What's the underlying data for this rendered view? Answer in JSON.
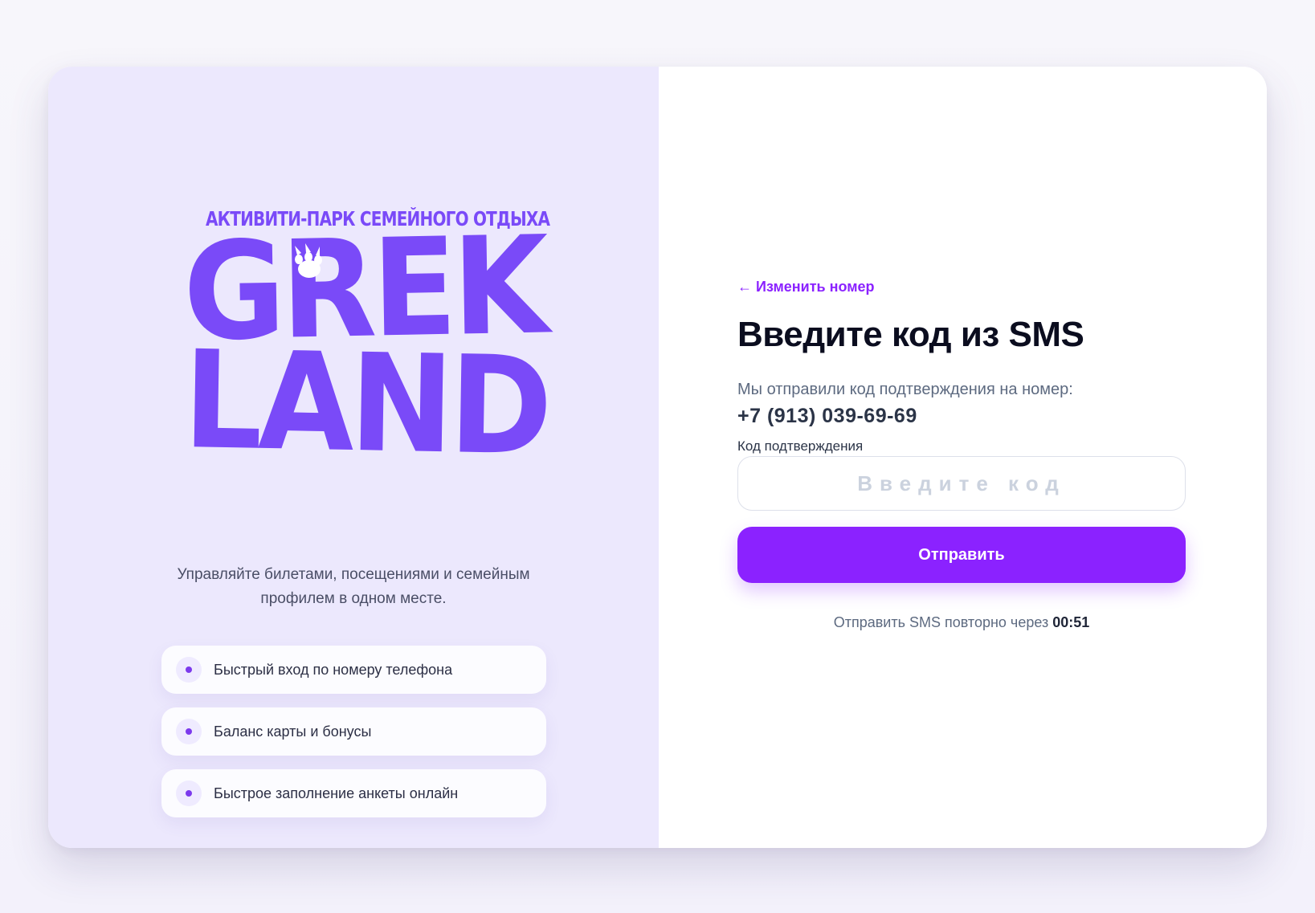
{
  "brand": {
    "tagline": "АКТИВИТИ-ПАРК СЕМЕЙНОГО ОТДЫХА",
    "word_line_1": "GREK",
    "word_line_2": "LAND",
    "color": "#7a4af8"
  },
  "left": {
    "description": "Управляйте билетами, посещениями и семейным профилем в одном месте.",
    "features": [
      "Быстрый вход по номеру телефона",
      "Баланс карты и бонусы",
      "Быстрое заполнение анкеты онлайн"
    ]
  },
  "form": {
    "back_link": "← Изменить номер",
    "title": "Введите код из SMS",
    "sent_text": "Мы отправили код подтверждения на номер:",
    "phone": "+7 (913) 039-69-69",
    "code_label": "Код подтверждения",
    "code_value": "",
    "code_placeholder": "Введите код",
    "submit_label": "Отправить",
    "resend_text": "Отправить SMS повторно через",
    "resend_timer": "00:51",
    "accent_color": "#8b22ff"
  }
}
